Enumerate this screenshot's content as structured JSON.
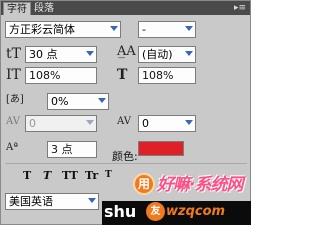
{
  "tabs": [
    {
      "label": "字符"
    },
    {
      "label": "段落"
    }
  ],
  "panel_menu_icon": "panel-menu-icon",
  "font": {
    "family": "方正彩云简体",
    "style": "-"
  },
  "size": {
    "value": "30 点"
  },
  "leading": {
    "value": "(自动)"
  },
  "vertical_scale": {
    "value": "108%"
  },
  "horizontal_scale": {
    "value": "108%"
  },
  "tsume": {
    "value": "0%"
  },
  "kerning": {
    "value": "0"
  },
  "tracking": {
    "value": "0"
  },
  "baseline_shift": {
    "value": "3 点"
  },
  "color": {
    "label": "颜色:",
    "hex": "#e02027"
  },
  "style_buttons": [
    "T",
    "T",
    "TT",
    "Tr",
    "T"
  ],
  "language": {
    "value": "美国英语"
  },
  "watermark": {
    "circle": "用",
    "text": "好嘛·系统网",
    "shu": "shu",
    "logo": "友",
    "url": "wzqcom"
  }
}
